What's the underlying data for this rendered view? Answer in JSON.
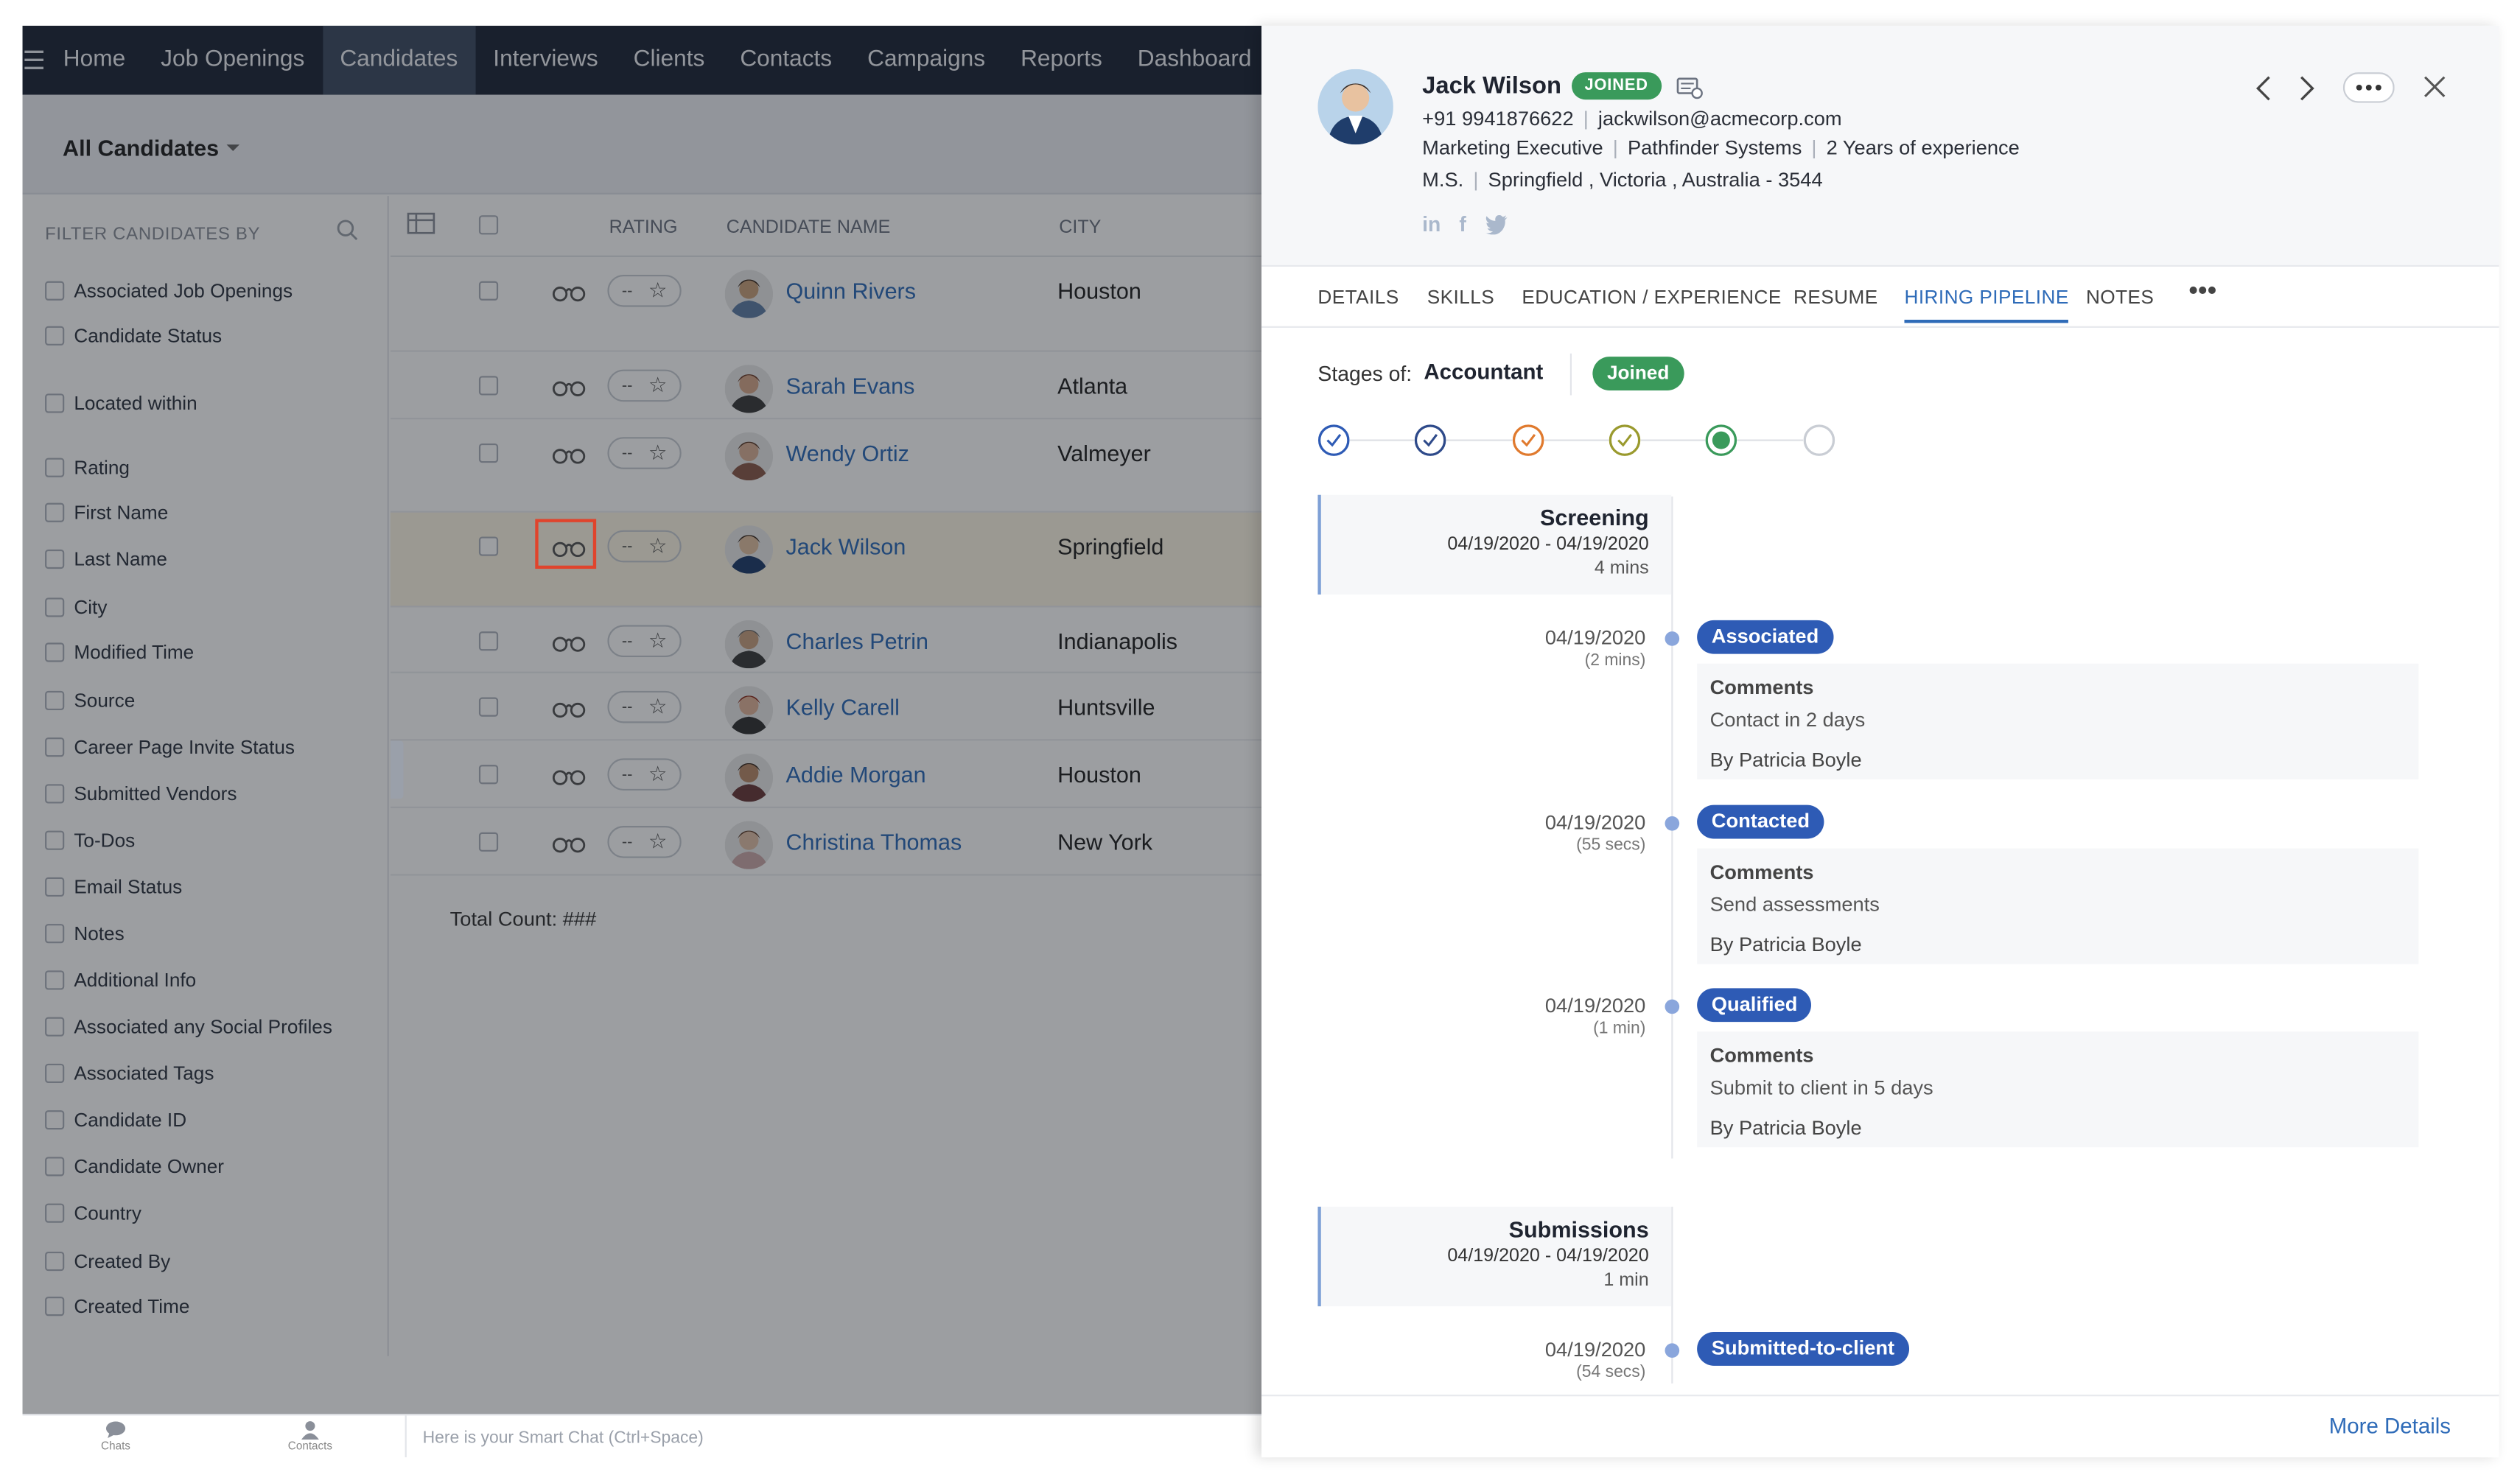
{
  "nav": {
    "items": [
      "Home",
      "Job Openings",
      "Candidates",
      "Interviews",
      "Clients",
      "Contacts",
      "Campaigns",
      "Reports",
      "Dashboard"
    ],
    "active": "Candidates"
  },
  "view_selector": "All Candidates",
  "filters": {
    "heading": "FILTER CANDIDATES BY",
    "items": [
      "Associated Job Openings",
      "Candidate Status",
      "Located within",
      "Rating",
      "First Name",
      "Last Name",
      "City",
      "Modified Time",
      "Source",
      "Career Page Invite Status",
      "Submitted Vendors",
      "To-Dos",
      "Email Status",
      "Notes",
      "Additional Info",
      "Associated any Social Profiles",
      "Associated Tags",
      "Candidate ID",
      "Candidate Owner",
      "Country",
      "Created By",
      "Created Time"
    ]
  },
  "grid": {
    "columns": {
      "rating": "RATING",
      "name": "CANDIDATE NAME",
      "city": "CITY"
    },
    "rating_placeholder": "--",
    "rows": [
      {
        "name": "Quinn Rivers",
        "city": "Houston"
      },
      {
        "name": "Sarah Evans",
        "city": "Atlanta"
      },
      {
        "name": "Wendy Ortiz",
        "city": "Valmeyer"
      },
      {
        "name": "Jack Wilson",
        "city": "Springfield"
      },
      {
        "name": "Charles Petrin",
        "city": "Indianapolis"
      },
      {
        "name": "Kelly Carell",
        "city": "Huntsville"
      },
      {
        "name": "Addie Morgan",
        "city": "Houston"
      },
      {
        "name": "Christina Thomas",
        "city": "New York"
      }
    ],
    "total": "Total Count: ###"
  },
  "footer": {
    "chats": "Chats",
    "contacts": "Contacts",
    "chat_placeholder": "Here is your Smart Chat (Ctrl+Space)"
  },
  "candidate": {
    "name": "Jack Wilson",
    "status": "JOINED",
    "phone": "+91 9941876622",
    "email": "jackwilson@acmecorp.com",
    "title": "Marketing Executive",
    "company": "Pathfinder Systems",
    "experience": "2 Years of experience",
    "degree": "M.S.",
    "address": "Springfield , Victoria , Australia - 3544"
  },
  "tabs": [
    "DETAILS",
    "SKILLS",
    "EDUCATION / EXPERIENCE",
    "RESUME",
    "HIRING PIPELINE",
    "NOTES"
  ],
  "active_tab": "HIRING PIPELINE",
  "pipeline": {
    "stages_label": "Stages of:",
    "job": "Accountant",
    "status": "Joined",
    "step_colors": [
      "#2e5bb5",
      "#2e4a8a",
      "#e07a2e",
      "#9a9a2e",
      "#3a9a5b",
      "#c9cdd4"
    ],
    "sections": [
      {
        "title": "Screening",
        "dates": "04/19/2020 - 04/19/2020",
        "duration": "4 mins"
      },
      {
        "title": "Submissions",
        "dates": "04/19/2020 - 04/19/2020",
        "duration": "1 min"
      }
    ],
    "events": [
      {
        "date": "04/19/2020",
        "dur": "(2 mins)",
        "badge": "Associated",
        "comments_label": "Comments",
        "comment": "Contact in 2 days",
        "by": "By Patricia Boyle"
      },
      {
        "date": "04/19/2020",
        "dur": "(55 secs)",
        "badge": "Contacted",
        "comments_label": "Comments",
        "comment": "Send assessments",
        "by": "By Patricia Boyle"
      },
      {
        "date": "04/19/2020",
        "dur": "(1 min)",
        "badge": "Qualified",
        "comments_label": "Comments",
        "comment": "Submit to client in 5 days",
        "by": "By Patricia Boyle"
      },
      {
        "date": "04/19/2020",
        "dur": "(54 secs)",
        "badge": "Submitted-to-client"
      }
    ]
  },
  "more_details": "More Details"
}
